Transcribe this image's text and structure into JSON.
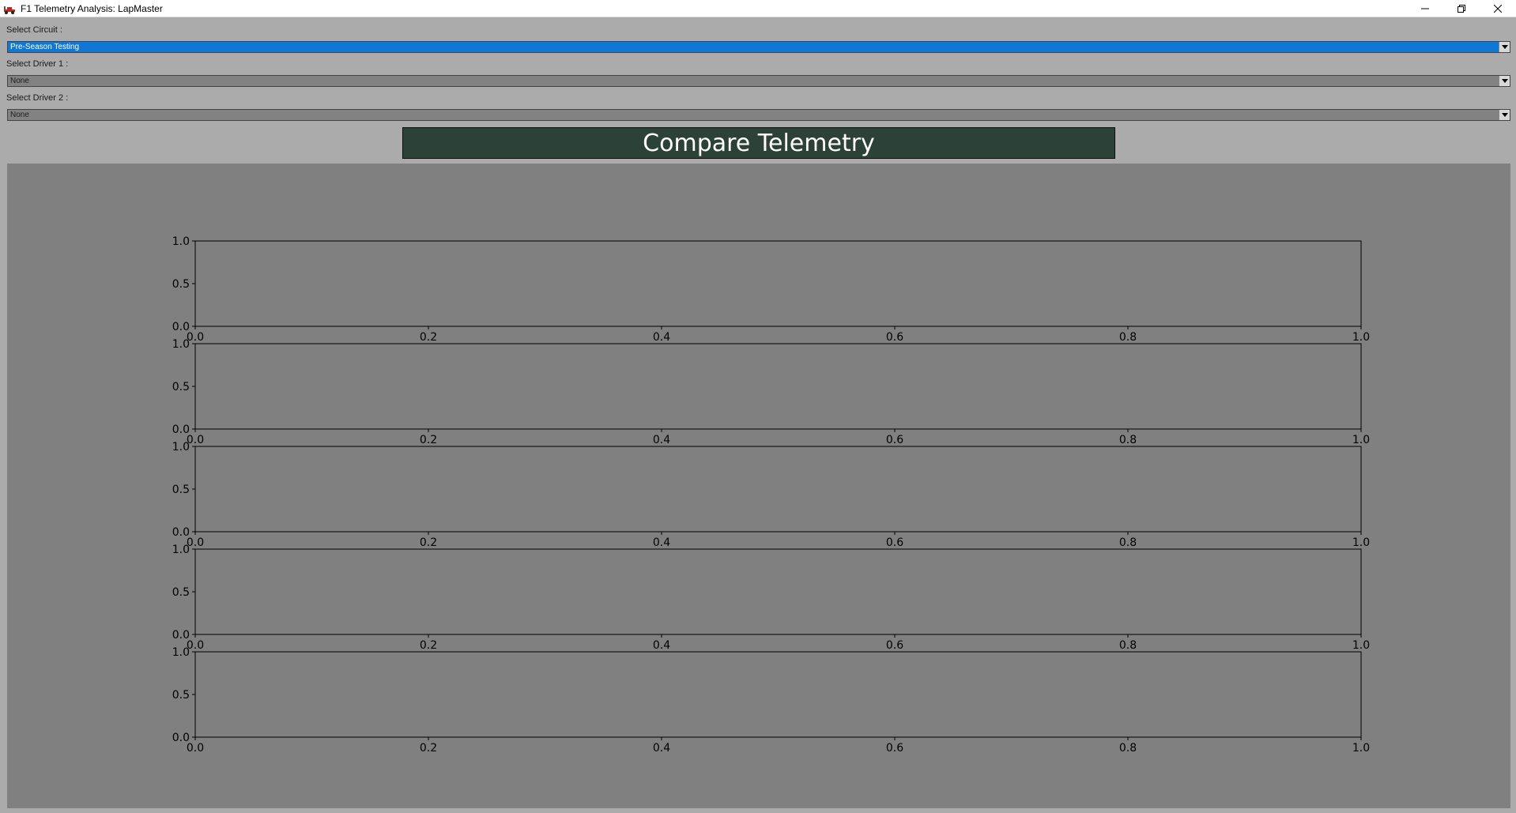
{
  "window": {
    "title": "F1 Telemetry Analysis: LapMaster",
    "icons": {
      "app": "f1-car-icon",
      "minimize": "minimize-icon",
      "restore": "restore-icon",
      "close": "close-icon"
    }
  },
  "controls": {
    "circuit": {
      "label": "Select Circuit :",
      "value": "Pre-Season Testing"
    },
    "driver1": {
      "label": "Select Driver 1 :",
      "value": "None"
    },
    "driver2": {
      "label": "Select Driver 2 :",
      "value": "None"
    },
    "compare_button": "Compare Telemetry"
  },
  "colors": {
    "window_bg": "#ababab",
    "plot_bg": "#808080",
    "selected_combo": "#0f78d7",
    "button_bg": "#2c4137"
  },
  "chart_data": [
    {
      "type": "line",
      "series": [],
      "xlim": [
        0,
        1
      ],
      "ylim": [
        0,
        1
      ],
      "xticks": [
        "0.0",
        "0.2",
        "0.4",
        "0.6",
        "0.8",
        "1.0"
      ],
      "yticks": [
        "0.0",
        "0.5",
        "1.0"
      ],
      "grid": false
    },
    {
      "type": "line",
      "series": [],
      "xlim": [
        0,
        1
      ],
      "ylim": [
        0,
        1
      ],
      "xticks": [
        "0.0",
        "0.2",
        "0.4",
        "0.6",
        "0.8",
        "1.0"
      ],
      "yticks": [
        "0.0",
        "0.5",
        "1.0"
      ],
      "grid": false
    },
    {
      "type": "line",
      "series": [],
      "xlim": [
        0,
        1
      ],
      "ylim": [
        0,
        1
      ],
      "xticks": [
        "0.0",
        "0.2",
        "0.4",
        "0.6",
        "0.8",
        "1.0"
      ],
      "yticks": [
        "0.0",
        "0.5",
        "1.0"
      ],
      "grid": false
    },
    {
      "type": "line",
      "series": [],
      "xlim": [
        0,
        1
      ],
      "ylim": [
        0,
        1
      ],
      "xticks": [
        "0.0",
        "0.2",
        "0.4",
        "0.6",
        "0.8",
        "1.0"
      ],
      "yticks": [
        "0.0",
        "0.5",
        "1.0"
      ],
      "grid": false
    },
    {
      "type": "line",
      "series": [],
      "xlim": [
        0,
        1
      ],
      "ylim": [
        0,
        1
      ],
      "xticks": [
        "0.0",
        "0.2",
        "0.4",
        "0.6",
        "0.8",
        "1.0"
      ],
      "yticks": [
        "0.0",
        "0.5",
        "1.0"
      ],
      "grid": false
    }
  ]
}
